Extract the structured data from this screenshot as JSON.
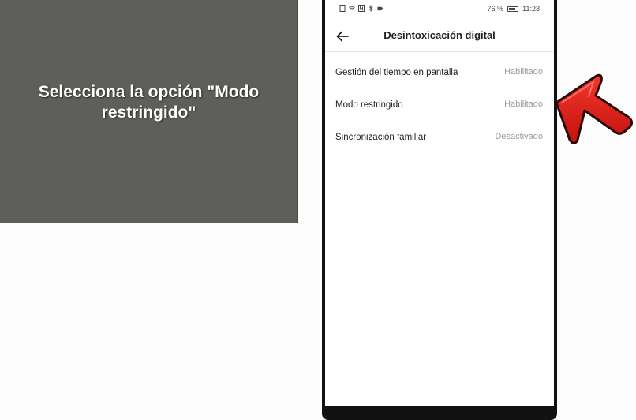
{
  "caption": {
    "text": "Selecciona la opción \"Modo restringido\""
  },
  "status_bar": {
    "battery_percent": "76 %",
    "time": "11:23"
  },
  "header": {
    "title": "Desintoxicación digital"
  },
  "settings": [
    {
      "label": "Gestión del tiempo en pantalla",
      "value": "Habilitado"
    },
    {
      "label": "Modo restringido",
      "value": "Habilitado"
    },
    {
      "label": "Sincronización familiar",
      "value": "Desactivado"
    }
  ],
  "icons": {
    "back": "arrow-left-icon",
    "pointer": "red-arrow-icon"
  },
  "colors": {
    "caption_bg": "#5e5e5b",
    "arrow_fill": "#e8201a",
    "value_text": "#9a9a9a"
  }
}
